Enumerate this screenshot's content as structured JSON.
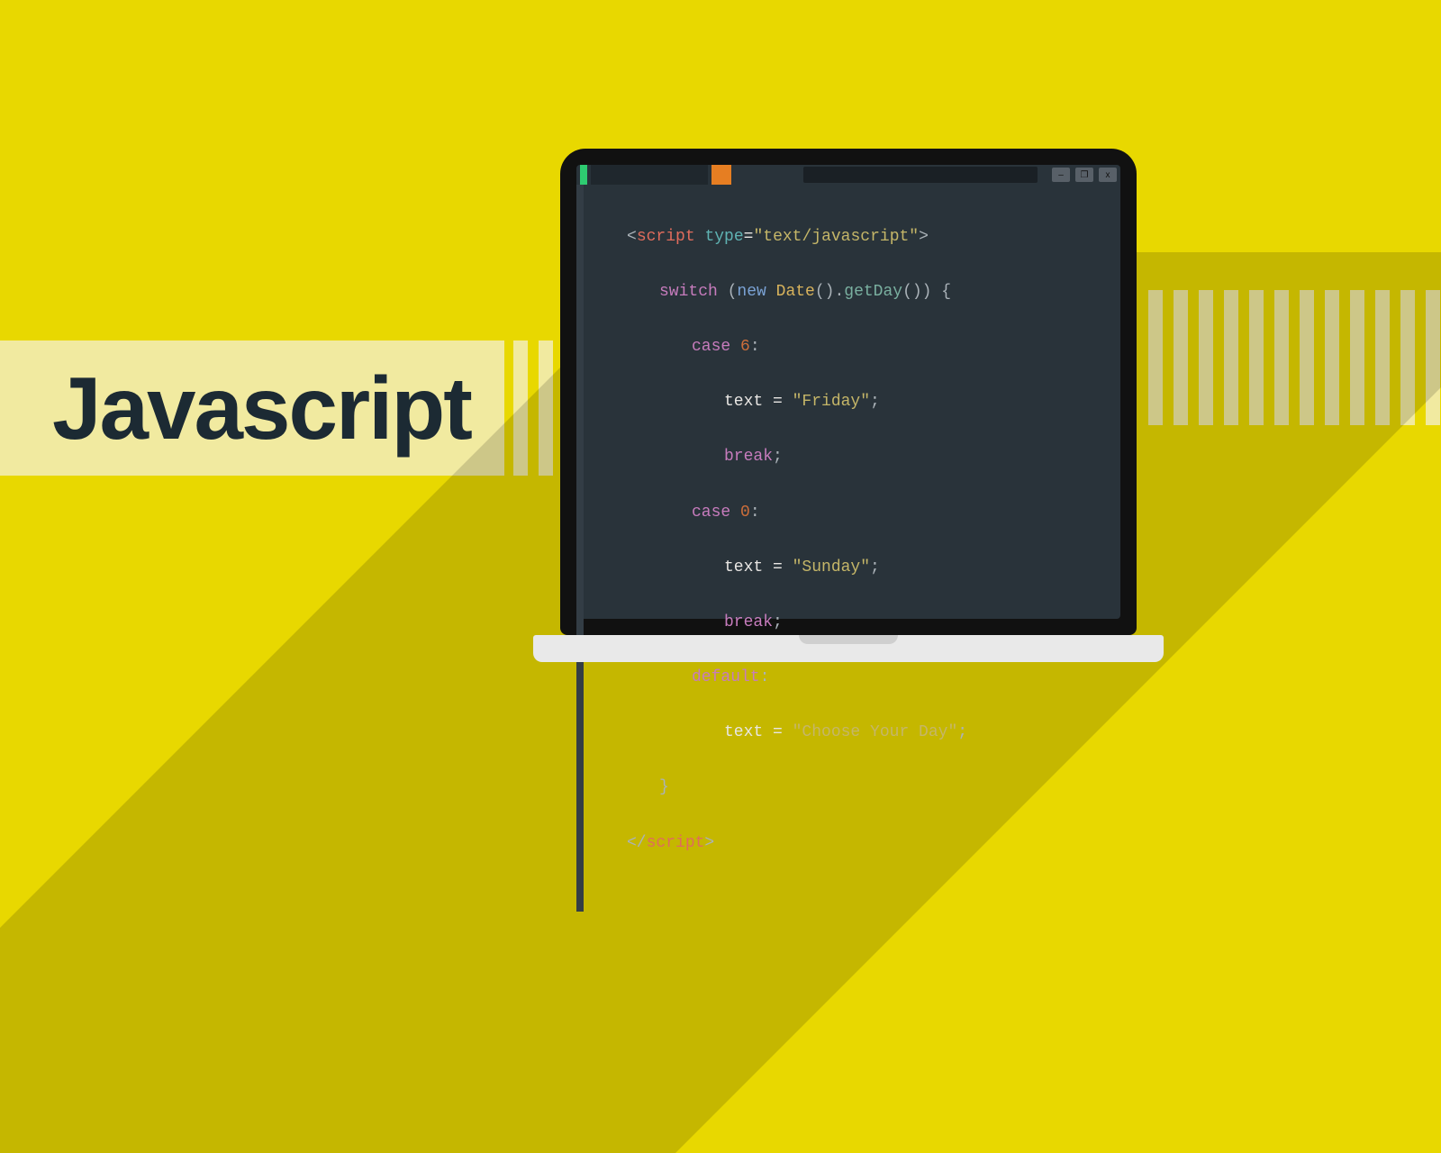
{
  "title": "Javascript",
  "window_controls": {
    "min": "–",
    "max": "❐",
    "close": "x"
  },
  "code": {
    "l1_open_lt": "<",
    "l1_tag": "script",
    "l1_space": " ",
    "l1_attr": "type",
    "l1_eq": "=",
    "l1_val": "\"text/javascript\"",
    "l1_gt": ">",
    "l2_kw": "switch",
    "l2_sp": " (",
    "l2_new": "new",
    "l2_sp2": " ",
    "l2_cls": "Date",
    "l2_paren": "().",
    "l2_fn": "getDay",
    "l2_end": "()) {",
    "l3_case": "case",
    "l3_sp": " ",
    "l3_num": "6",
    "l3_colon": ":",
    "l4_ident": "text",
    "l4_eq": " = ",
    "l4_str": "\"Friday\"",
    "l4_semi": ";",
    "l5_break": "break",
    "l5_semi": ";",
    "l6_case": "case",
    "l6_sp": " ",
    "l6_num": "0",
    "l6_colon": ":",
    "l7_ident": "text",
    "l7_eq": " = ",
    "l7_str": "\"Sunday\"",
    "l7_semi": ";",
    "l8_break": "break",
    "l8_semi": ";",
    "l9_default": "default",
    "l9_colon": ":",
    "l10_ident": "text",
    "l10_eq": " = ",
    "l10_str": "\"Choose Your Day\"",
    "l10_semi": ";",
    "l11_brace": "}",
    "l12_lt": "</",
    "l12_tag": "script",
    "l12_gt": ">"
  }
}
